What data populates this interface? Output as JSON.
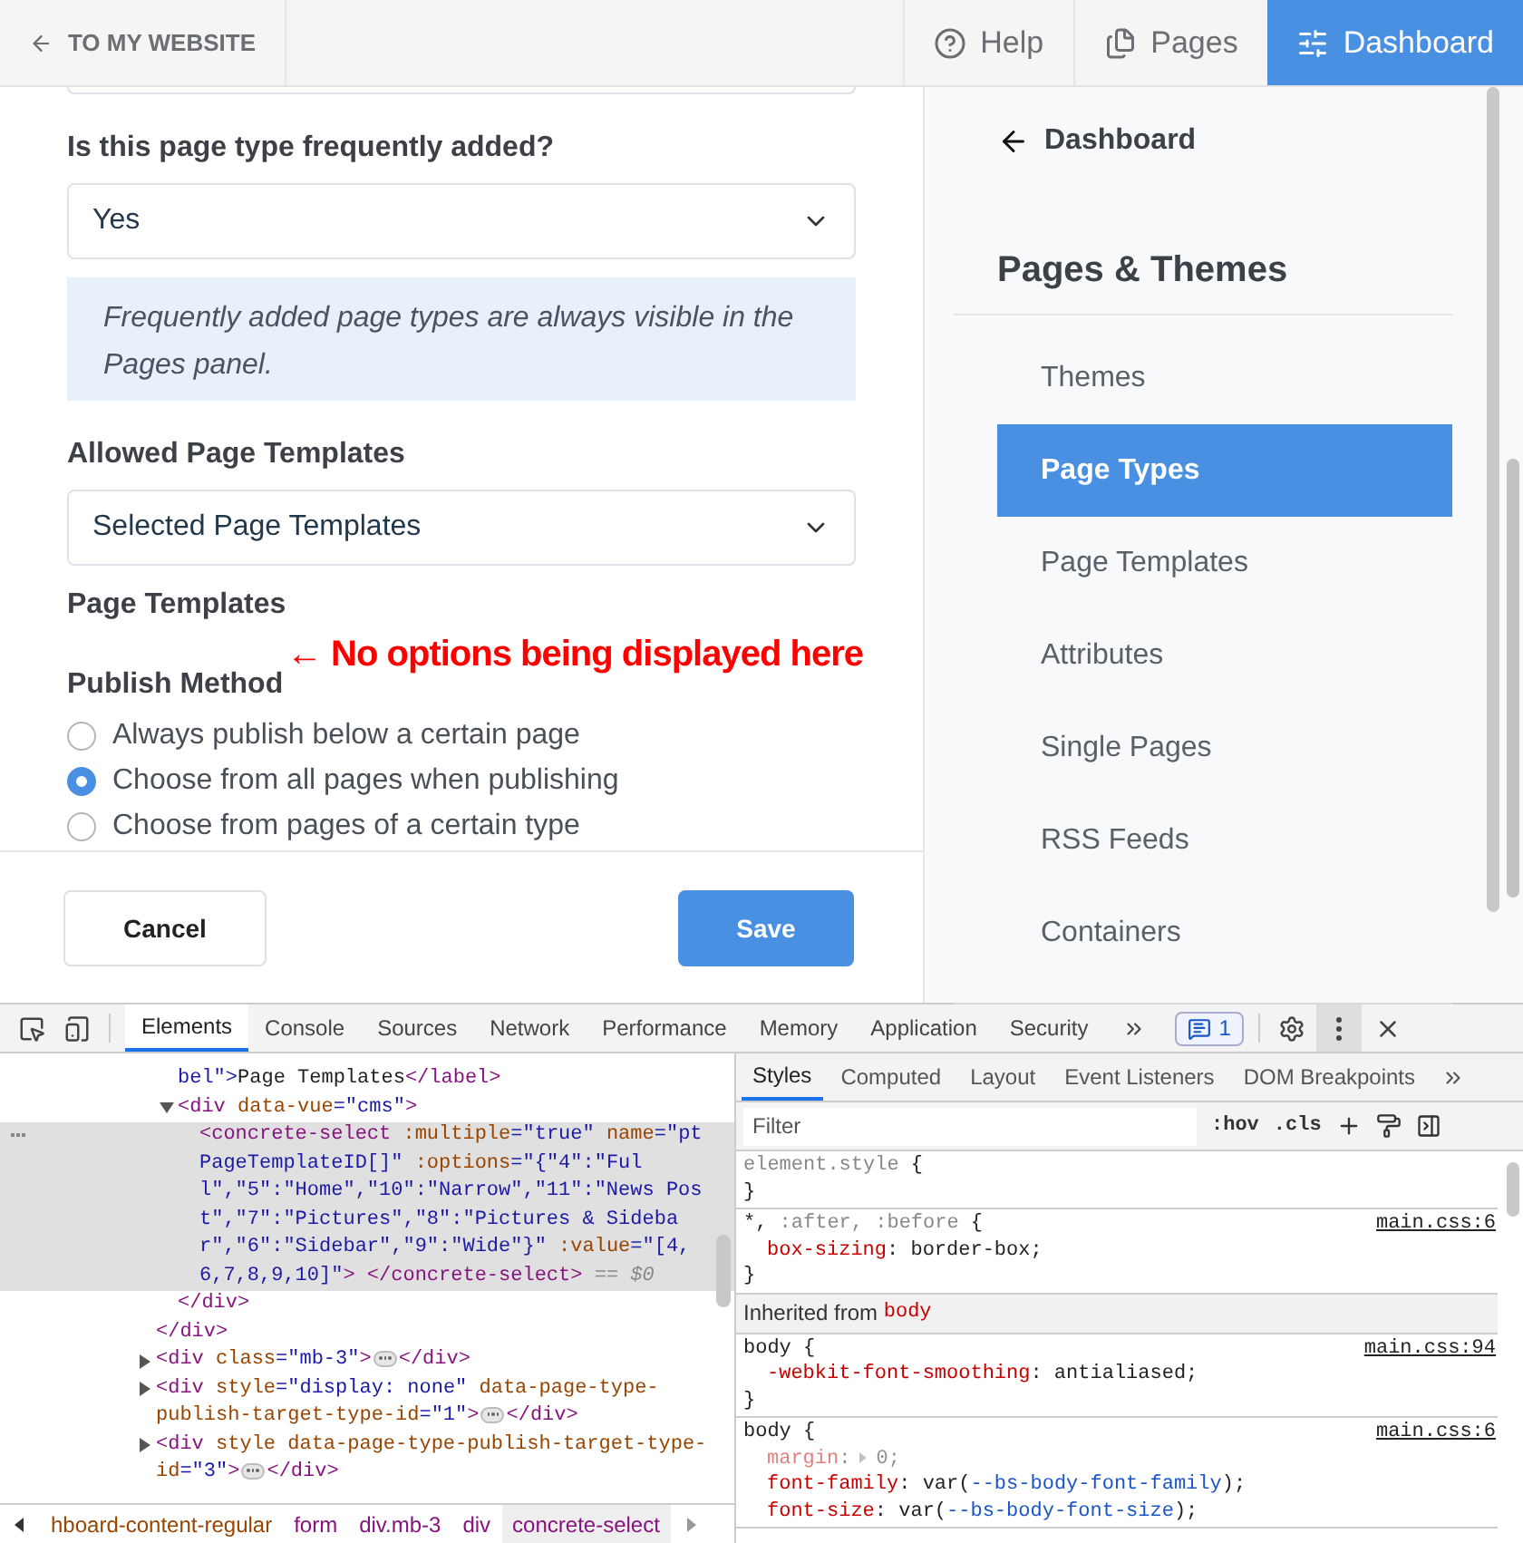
{
  "top_bar": {
    "back_link": "TO MY WEBSITE",
    "nav": [
      {
        "label": "Help",
        "selected": false
      },
      {
        "label": "Pages",
        "selected": false
      },
      {
        "label": "Dashboard",
        "selected": true
      }
    ]
  },
  "form": {
    "fields": [
      {
        "kind": "select",
        "label": "Is this page type frequently added?",
        "value": "Yes"
      },
      {
        "kind": "note",
        "text": "Frequently added page types are always visible in the Pages panel."
      },
      {
        "kind": "select",
        "label": "Allowed Page Templates",
        "value": "Selected Page Templates"
      },
      {
        "kind": "heading",
        "label": "Page Templates"
      },
      {
        "kind": "radios",
        "label": "Publish Method",
        "options": [
          {
            "label": "Always publish below a certain page",
            "selected": false
          },
          {
            "label": "Choose from all pages when publishing",
            "selected": true
          },
          {
            "label": "Choose from pages of a certain type",
            "selected": false
          }
        ]
      }
    ],
    "annotation": "← No options being displayed here",
    "buttons": [
      {
        "label": "Cancel",
        "kind": "secondary"
      },
      {
        "label": "Save",
        "kind": "primary"
      }
    ]
  },
  "sidebar": {
    "back": "Dashboard",
    "title": "Pages & Themes",
    "items": [
      {
        "label": "Themes",
        "selected": false
      },
      {
        "label": "Page Types",
        "selected": true
      },
      {
        "label": "Page Templates",
        "selected": false
      },
      {
        "label": "Attributes",
        "selected": false
      },
      {
        "label": "Single Pages",
        "selected": false
      },
      {
        "label": "RSS Feeds",
        "selected": false
      },
      {
        "label": "Containers",
        "selected": false
      }
    ]
  },
  "devtools": {
    "tabs": [
      {
        "label": "Elements",
        "selected": true
      },
      {
        "label": "Console",
        "selected": false
      },
      {
        "label": "Sources",
        "selected": false
      },
      {
        "label": "Network",
        "selected": false
      },
      {
        "label": "Performance",
        "selected": false
      },
      {
        "label": "Memory",
        "selected": false
      },
      {
        "label": "Application",
        "selected": false
      },
      {
        "label": "Security",
        "selected": false
      }
    ],
    "message_count": "1",
    "elements": [
      {
        "selected": false,
        "children": [
          {
            "selected": false,
            "lines": [
              [
                {
                  "kind": "value",
                  "text": "bel\">"
                },
                {
                  "kind": "text",
                  "text": "Page Templates"
                },
                {
                  "kind": "tag",
                  "text": "</label>"
                }
              ]
            ]
          },
          {
            "selected": false,
            "expanded": true,
            "lines": [
              [
                {
                  "kind": "tag",
                  "text": "<div "
                },
                {
                  "kind": "attr",
                  "text": "data-vue"
                },
                {
                  "kind": "value",
                  "text": "=\"cms\""
                },
                {
                  "kind": "tag",
                  "text": ">"
                }
              ]
            ],
            "children": [
              {
                "selected": true,
                "lines": [
                  [
                    {
                      "kind": "tag",
                      "text": "<concrete-select"
                    },
                    {
                      "kind": "attr",
                      "text": " :multiple"
                    },
                    {
                      "kind": "value",
                      "text": "=\"true\""
                    },
                    {
                      "kind": "attr",
                      "text": " name"
                    },
                    {
                      "kind": "value",
                      "text": "=\"pt"
                    }
                  ],
                  [
                    {
                      "kind": "value",
                      "text": "PageTemplateID[]\""
                    },
                    {
                      "kind": "attr",
                      "text": " :options"
                    },
                    {
                      "kind": "value",
                      "text": "=\"{\"4\":\"Ful"
                    }
                  ],
                  [
                    {
                      "kind": "value",
                      "text": "l\",\"5\":\"Home\",\"10\":\"Narrow\",\"11\":\"News Pos"
                    }
                  ],
                  [
                    {
                      "kind": "value",
                      "text": "t\",\"7\":\"Pictures\",\"8\":\"Pictures & Sideba"
                    }
                  ],
                  [
                    {
                      "kind": "value",
                      "text": "r\",\"6\":\"Sidebar\",\"9\":\"Wide\"}\""
                    },
                    {
                      "kind": "attr",
                      "text": " :value"
                    },
                    {
                      "kind": "value",
                      "text": "=\"[4,"
                    }
                  ],
                  [
                    {
                      "kind": "value",
                      "text": "6,7,8,9,10]\""
                    },
                    {
                      "kind": "tag",
                      "text": "> </concrete-select>"
                    },
                    {
                      "kind": "comment",
                      "text": " == $0"
                    }
                  ]
                ]
              }
            ],
            "close": [
              {
                "kind": "tag",
                "text": "</div>"
              }
            ]
          }
        ],
        "close": [
          {
            "kind": "tag",
            "text": "</div>"
          }
        ]
      },
      {
        "selected": false,
        "expanded": false,
        "lines": [
          [
            {
              "kind": "tag",
              "text": "<div "
            },
            {
              "kind": "attr",
              "text": "class"
            },
            {
              "kind": "value",
              "text": "=\"mb-3\""
            },
            {
              "kind": "tag",
              "text": ">"
            },
            {
              "kind": "more"
            },
            {
              "kind": "tag",
              "text": "</div>"
            }
          ]
        ]
      },
      {
        "selected": false,
        "expanded": false,
        "lines": [
          [
            {
              "kind": "tag",
              "text": "<div "
            },
            {
              "kind": "attr",
              "text": "style"
            },
            {
              "kind": "value",
              "text": "=\"display: none\""
            },
            {
              "kind": "attr",
              "text": " data-page-type-"
            }
          ],
          [
            {
              "kind": "attr",
              "text": "publish-target-type-id"
            },
            {
              "kind": "value",
              "text": "=\"1\""
            },
            {
              "kind": "tag",
              "text": ">"
            },
            {
              "kind": "more"
            },
            {
              "kind": "tag",
              "text": "</div>"
            }
          ]
        ]
      },
      {
        "selected": false,
        "expanded": false,
        "lines": [
          [
            {
              "kind": "tag",
              "text": "<div "
            },
            {
              "kind": "attr",
              "text": "style data-page-type-publish-target-type-"
            }
          ],
          [
            {
              "kind": "attr",
              "text": "id"
            },
            {
              "kind": "value",
              "text": "=\"3\""
            },
            {
              "kind": "tag",
              "text": ">"
            },
            {
              "kind": "more"
            },
            {
              "kind": "tag",
              "text": "</div>"
            }
          ]
        ]
      }
    ],
    "breadcrumbs": [
      {
        "label": "hboard-content-regular",
        "kind": "class",
        "selected": false
      },
      {
        "label": "form",
        "kind": "tag",
        "selected": false
      },
      {
        "label": "div.mb-3",
        "kind": "tag",
        "selected": false
      },
      {
        "label": "div",
        "kind": "tag",
        "selected": false
      },
      {
        "label": "concrete-select",
        "kind": "tag",
        "selected": true
      }
    ],
    "styles_tabs": [
      {
        "label": "Styles",
        "selected": true
      },
      {
        "label": "Computed",
        "selected": false
      },
      {
        "label": "Layout",
        "selected": false
      },
      {
        "label": "Event Listeners",
        "selected": false
      },
      {
        "label": "DOM Breakpoints",
        "selected": false
      }
    ],
    "filter": {
      "placeholder": "Filter"
    },
    "filter_toggles": [
      ":hov",
      ".cls"
    ],
    "rules": [
      {
        "kind": "rule",
        "selector": [
          {
            "text": "element.style",
            "matched": false
          },
          {
            "text": " {",
            "matched": true
          }
        ],
        "close": "}"
      },
      {
        "kind": "rule",
        "source": "main.css:6",
        "selector": [
          {
            "text": "*,",
            "matched": true
          },
          {
            "text": " :after, :before",
            "matched": false
          },
          {
            "text": " {",
            "matched": true
          }
        ],
        "declarations": [
          {
            "overridden": false,
            "parts": [
              {
                "kind": "property",
                "text": "box-sizing"
              },
              {
                "kind": "plain",
                "text": ": border-box;"
              }
            ]
          }
        ],
        "close": "}"
      },
      {
        "kind": "inherited",
        "parts": [
          {
            "kind": "plain",
            "text": "Inherited from "
          },
          {
            "kind": "property",
            "text": "body"
          }
        ]
      },
      {
        "kind": "rule",
        "source": "main.css:94",
        "selector": [
          {
            "text": "body {",
            "matched": true
          }
        ],
        "declarations": [
          {
            "overridden": false,
            "parts": [
              {
                "kind": "property",
                "text": "-webkit-font-smoothing"
              },
              {
                "kind": "plain",
                "text": ": antialiased;"
              }
            ]
          }
        ],
        "close": "}"
      },
      {
        "kind": "rule",
        "source": "main.css:6",
        "selector": [
          {
            "text": "body {",
            "matched": true
          }
        ],
        "declarations": [
          {
            "overridden": true,
            "parts": [
              {
                "kind": "property",
                "text": "margin"
              },
              {
                "kind": "plain",
                "text": ":"
              },
              {
                "kind": "expander"
              },
              {
                "kind": "plain",
                "text": "0;"
              }
            ]
          },
          {
            "overridden": false,
            "parts": [
              {
                "kind": "property",
                "text": "font-family"
              },
              {
                "kind": "plain",
                "text": ": var("
              },
              {
                "kind": "variable",
                "text": "--bs-body-font-family"
              },
              {
                "kind": "plain",
                "text": ");"
              }
            ]
          },
          {
            "overridden": false,
            "parts": [
              {
                "kind": "property",
                "text": "font-size"
              },
              {
                "kind": "plain",
                "text": ": var("
              },
              {
                "kind": "variable",
                "text": "--bs-body-font-size"
              },
              {
                "kind": "plain",
                "text": ");"
              }
            ]
          }
        ]
      }
    ]
  }
}
